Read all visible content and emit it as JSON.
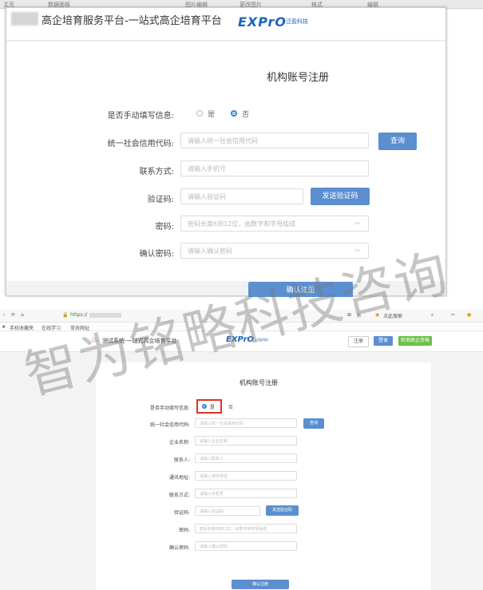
{
  "top": {
    "chrome_fragments": [
      "主页",
      "数据面板",
      "图片编辑",
      "更改图片",
      "格式",
      "编辑"
    ],
    "platform_title": "高企培育服务平台-一站式高企培育平台",
    "logo_main": "EXPrO",
    "logo_sub": "泛盈科技",
    "form_title": "机构账号注册",
    "manual_label": "是否手动填写信息:",
    "radio_yes": "是",
    "radio_no": "否",
    "credit_label": "统一社会信用代码:",
    "credit_placeholder": "请输入统一社会信用代码",
    "query_button": "查询",
    "phone_label": "联系方式:",
    "phone_placeholder": "请输入手机号",
    "code_label": "验证码:",
    "code_placeholder": "请输入验证码",
    "send_code_button": "发送验证码",
    "password_label": "密码:",
    "password_placeholder": "密码长度6到12位，由数字和字母组成",
    "confirm_label": "确认密码:",
    "confirm_placeholder": "请输入确认密码",
    "submit_button": "确认注册"
  },
  "bottom": {
    "url_text": "https://",
    "search_text": "点此搜索",
    "fav_items": [
      "手机收藏夹",
      "在线学习",
      "常去网址"
    ],
    "platform_title": "测试系统-一站式高企培育平台",
    "logo_main": "EXPrO",
    "logo_sub": "泛盈科技",
    "header_buttons": [
      "注册",
      "登录",
      "检测高企资格"
    ],
    "form_title": "机构账号注册",
    "manual_label": "是否手动填写信息:",
    "radio_yes": "是",
    "radio_no": "否",
    "credit_label": "统一社会信用代码:",
    "credit_placeholder": "请输入统一社会信用代码",
    "query_button": "查询",
    "company_label": "企业名称:",
    "company_placeholder": "请输入企业名称",
    "contact_label": "联系人:",
    "contact_placeholder": "请输入联系人",
    "address_label": "通讯地址:",
    "address_placeholder": "请输入通讯地址",
    "phone_label": "联系方式:",
    "phone_placeholder": "请输入手机号",
    "code_label": "验证码:",
    "code_placeholder": "请输入验证码",
    "send_code_button": "发送验证码",
    "password_label": "密码:",
    "password_placeholder": "密码长度6到12位，由数字和字母组成",
    "confirm_label": "确认密码:",
    "confirm_placeholder": "请输入确认密码",
    "submit_button": "确认注册"
  },
  "watermark": "智为铭略科技咨询",
  "colors": {
    "brand_blue": "#1e65b8",
    "button_blue": "#5b8fd0",
    "green": "#6cc04a",
    "highlight_red": "#d9342b"
  }
}
